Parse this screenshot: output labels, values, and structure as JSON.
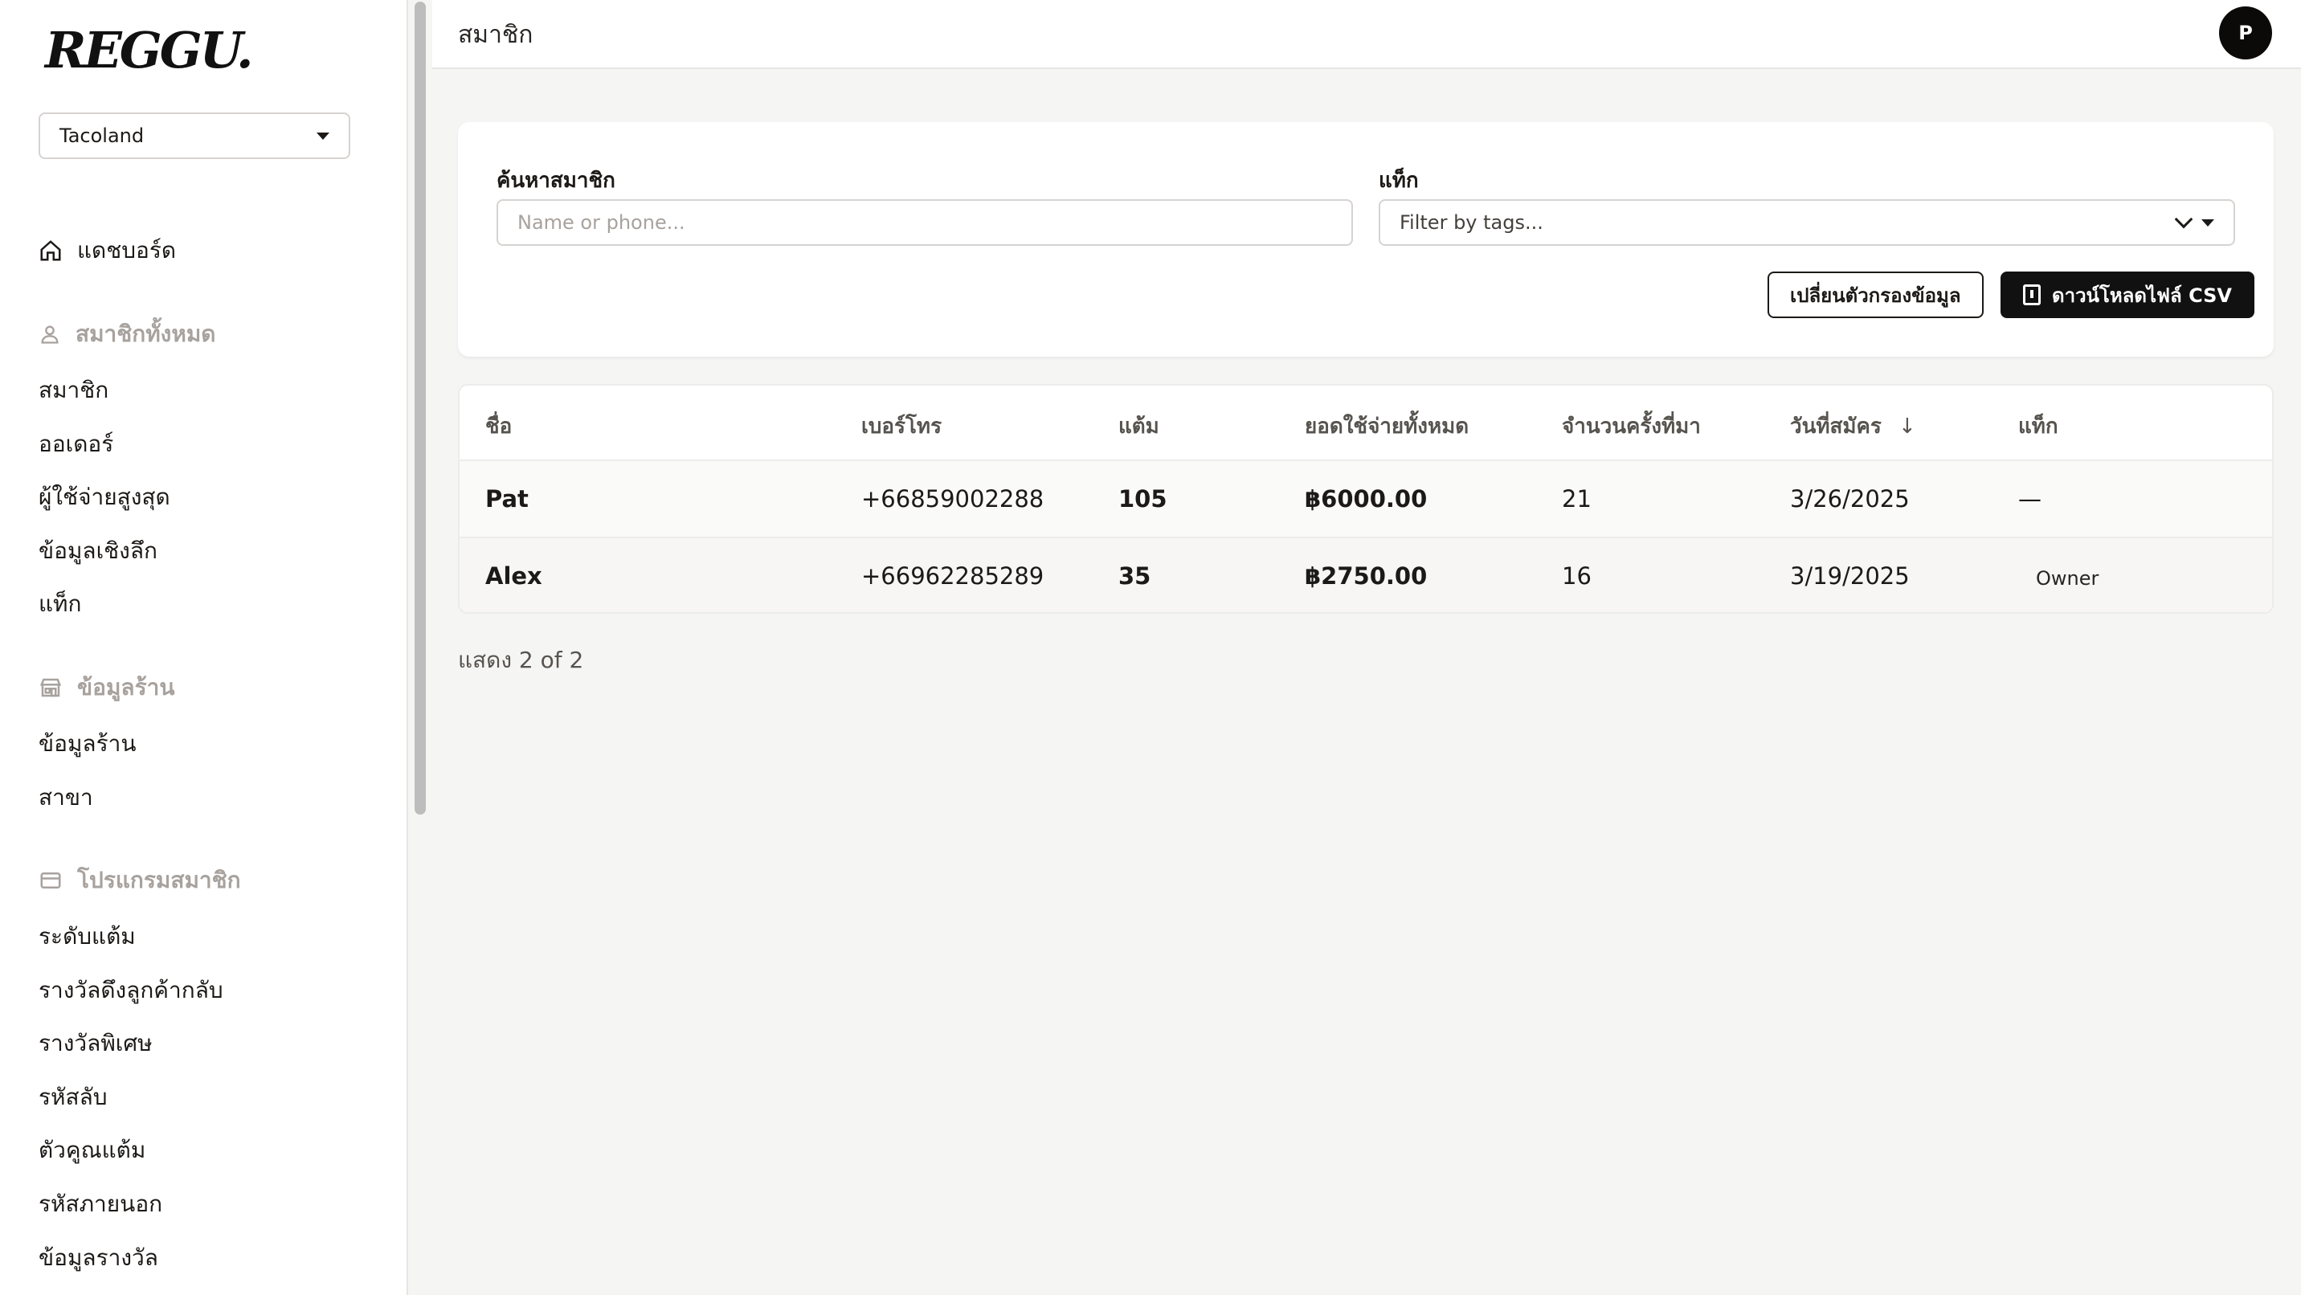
{
  "brand": {
    "logo": "REGGU."
  },
  "sidebar": {
    "shop_select": "Tacoland",
    "dashboard": "แดชบอร์ด",
    "sections": [
      {
        "title": "สมาชิกทั้งหมด",
        "items": [
          "สมาชิก",
          "ออเดอร์",
          "ผู้ใช้จ่ายสูงสุด",
          "ข้อมูลเชิงลึก",
          "แท็ก"
        ]
      },
      {
        "title": "ข้อมูลร้าน",
        "items": [
          "ข้อมูลร้าน",
          "สาขา"
        ]
      },
      {
        "title": "โปรแกรมสมาชิก",
        "items": [
          "ระดับแต้ม",
          "รางวัลดึงลูกค้ากลับ",
          "รางวัลพิเศษ",
          "รหัสลับ",
          "ตัวคูณแต้ม",
          "รหัสภายนอก",
          "ข้อมูลรางวัล"
        ]
      }
    ]
  },
  "header": {
    "title": "สมาชิก",
    "avatar_initial": "P"
  },
  "filters": {
    "search_label": "ค้นหาสมาชิก",
    "search_placeholder": "Name or phone...",
    "tag_label": "แท็ก",
    "tag_placeholder": "Filter by tags...",
    "change_filter_button": "เปลี่ยนตัวกรองข้อมูล",
    "download_button": "ดาวน์โหลดไฟล์ CSV"
  },
  "table": {
    "columns": [
      "ชื่อ",
      "เบอร์โทร",
      "แต้ม",
      "ยอดใช้จ่ายทั้งหมด",
      "จำนวนครั้งที่มา",
      "วันที่สมัคร",
      "แท็ก"
    ],
    "sort_indicator": "↓",
    "rows": [
      {
        "name": "Pat",
        "phone": "+66859002288",
        "points": "105",
        "spend": "฿6000.00",
        "visits": "21",
        "joined": "3/26/2025",
        "tags": "—"
      },
      {
        "name": "Alex",
        "phone": "+66962285289",
        "points": "35",
        "spend": "฿2750.00",
        "visits": "16",
        "joined": "3/19/2025",
        "tags": "Owner"
      }
    ]
  },
  "footer": {
    "count_text": "แสดง 2 of 2"
  }
}
